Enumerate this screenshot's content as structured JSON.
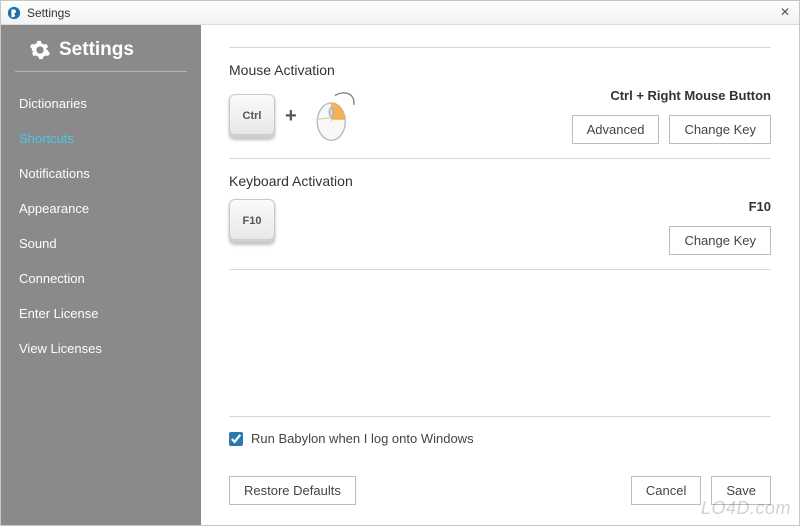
{
  "window": {
    "title": "Settings"
  },
  "sidebar": {
    "title": "Settings",
    "items": [
      {
        "label": "Dictionaries"
      },
      {
        "label": "Shortcuts"
      },
      {
        "label": "Notifications"
      },
      {
        "label": "Appearance"
      },
      {
        "label": "Sound"
      },
      {
        "label": "Connection"
      },
      {
        "label": "Enter License"
      },
      {
        "label": "View Licenses"
      }
    ],
    "active_index": 1
  },
  "mouse_activation": {
    "title": "Mouse Activation",
    "keycap": "Ctrl",
    "combo_text": "Ctrl  +  Right Mouse Button",
    "buttons": {
      "advanced": "Advanced",
      "change_key": "Change Key"
    }
  },
  "keyboard_activation": {
    "title": "Keyboard Activation",
    "keycap": "F10",
    "combo_text": "F10",
    "buttons": {
      "change_key": "Change Key"
    }
  },
  "footer": {
    "run_label": "Run Babylon when I log onto Windows",
    "run_checked": true,
    "restore": "Restore Defaults",
    "cancel": "Cancel",
    "save": "Save"
  },
  "watermark": "LO4D.com"
}
